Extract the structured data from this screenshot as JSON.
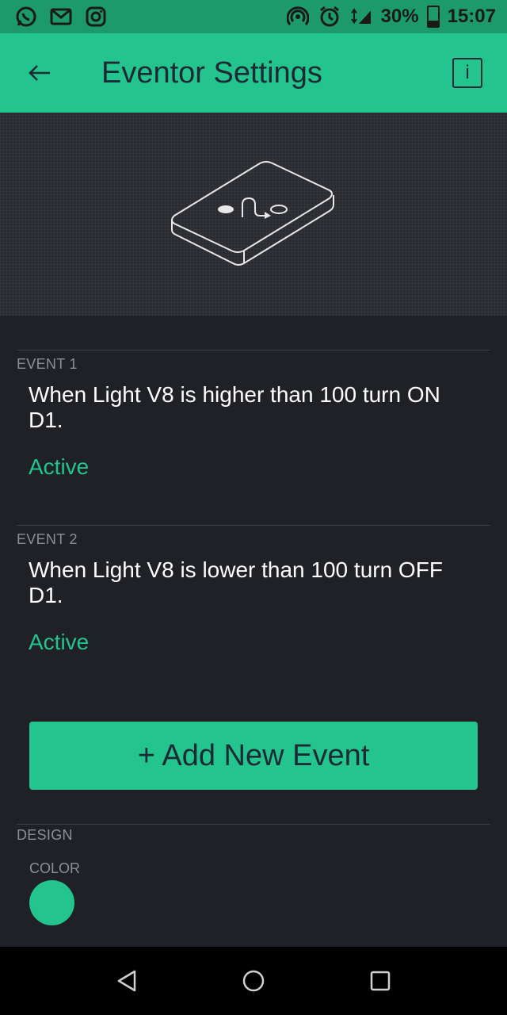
{
  "status_bar": {
    "icons_left": [
      "whatsapp-icon",
      "gmail-icon",
      "instagram-icon"
    ],
    "icons_right": [
      "hotspot-icon",
      "alarm-icon",
      "signal-icon",
      "battery-icon"
    ],
    "battery_percent": "30%",
    "time": "15:07"
  },
  "app_bar": {
    "title": "Eventor Settings",
    "info_label": "i"
  },
  "events": [
    {
      "label": "EVENT 1",
      "description": "When Light  V8 is higher than 100 turn ON D1.",
      "status": "Active"
    },
    {
      "label": "EVENT 2",
      "description": "When Light  V8 is lower than 100 turn OFF D1.",
      "status": "Active"
    }
  ],
  "add_button": {
    "label": "+ Add New Event"
  },
  "design": {
    "section_label": "DESIGN",
    "color_label": "COLOR",
    "color_value": "#23c48e"
  },
  "colors": {
    "accent": "#23c48e",
    "status_bar": "#1c9a6c",
    "background": "#1f2127"
  }
}
